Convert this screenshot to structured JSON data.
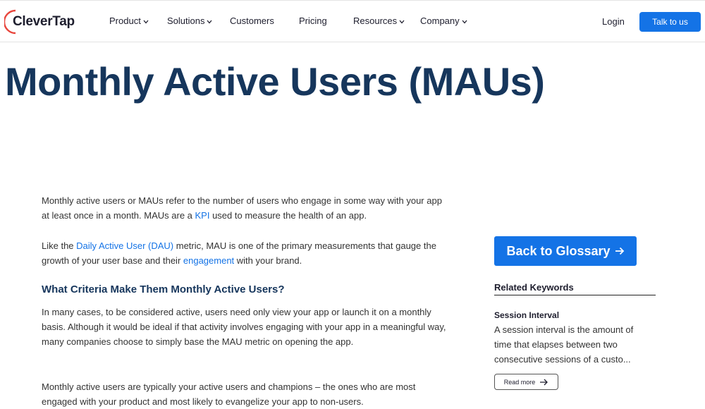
{
  "header": {
    "logo_text": "CleverTap",
    "nav": [
      {
        "label": "Product",
        "has_dropdown": true
      },
      {
        "label": "Solutions",
        "has_dropdown": true
      },
      {
        "label": "Customers",
        "has_dropdown": false
      },
      {
        "label": "Pricing",
        "has_dropdown": false
      },
      {
        "label": "Resources",
        "has_dropdown": true
      },
      {
        "label": "Company",
        "has_dropdown": true
      }
    ],
    "login_label": "Login",
    "cta_label": "Talk to us"
  },
  "page": {
    "title": "Monthly Active Users (MAUs)"
  },
  "article": {
    "p1_before": "Monthly active users or MAUs refer to the number of users who engage in some way with your app at least once in a month. MAUs are a ",
    "p1_link": "KPI",
    "p1_after": " used to measure the health of an app.",
    "p2_before": "Like the ",
    "p2_link1": "Daily Active User (DAU)",
    "p2_middle": " metric, MAU is one of the primary measurements that gauge the growth of your user base and their ",
    "p2_link2": "engagement",
    "p2_after": " with your brand.",
    "heading": "What Criteria Make Them Monthly Active Users?",
    "p3": "In many cases, to be considered active, users need only view your app or launch it on a monthly basis. Although it would be ideal if that activity involves engaging with your app in a meaningful way, many companies choose to simply base the MAU metric on opening the app.",
    "p4": "Monthly active users are typically your active users and champions – the ones who are most engaged with your product and most likely to evangelize your app to non-users."
  },
  "sidebar": {
    "back_label": "Back to Glossary",
    "related_heading": "Related Keywords",
    "keyword_title": "Session Interval",
    "keyword_desc": "A session interval is the amount of time that elapses between two consecutive sessions of a custo...",
    "read_more_label": "Read more"
  },
  "colors": {
    "accent": "#1473e6",
    "title": "#16365c",
    "logo_ring": "#e8453c"
  },
  "icons": [
    "chevron-down-icon",
    "arrow-right-icon"
  ]
}
